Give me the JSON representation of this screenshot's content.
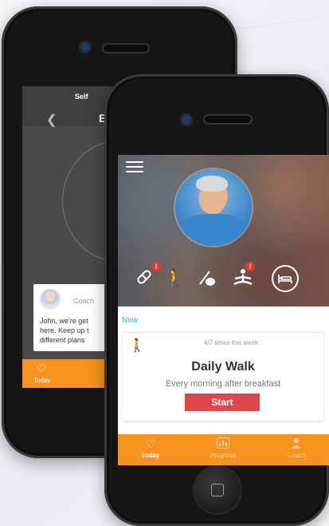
{
  "back_screen": {
    "tabs": [
      "Self",
      "E"
    ],
    "coach_label": "Coach",
    "message_lines": [
      "John, we're get",
      "here. Keep up t",
      "different plans"
    ],
    "bottom_tab": {
      "label": "Today",
      "icon": "heart-outline-icon"
    }
  },
  "front_screen": {
    "menu_icon": "hamburger-menu-icon",
    "profile_icon": "user-photo",
    "categories": [
      {
        "icon": "pill-icon",
        "alert": "!"
      },
      {
        "icon": "walking-icon",
        "alert": ""
      },
      {
        "icon": "food-icon",
        "alert": ""
      },
      {
        "icon": "meditation-icon",
        "alert": "!"
      },
      {
        "icon": "sleep-icon",
        "alert": ""
      }
    ],
    "section_label": "Now",
    "activity": {
      "progress_text": "4/7 times this week",
      "title": "Daily Walk",
      "subtitle": "Every morning after breakfast",
      "start_label": "Start"
    },
    "tabbar": [
      {
        "label": "Today",
        "icon": "heart-outline-icon",
        "active": true
      },
      {
        "label": "Progress",
        "icon": "chart-icon",
        "active": false
      },
      {
        "label": "Coach",
        "icon": "person-icon",
        "active": false
      }
    ]
  },
  "colors": {
    "accent": "#f7931e",
    "start_button": "#e0474c",
    "now_label": "#2ab3c9",
    "badge": "#e53935"
  }
}
